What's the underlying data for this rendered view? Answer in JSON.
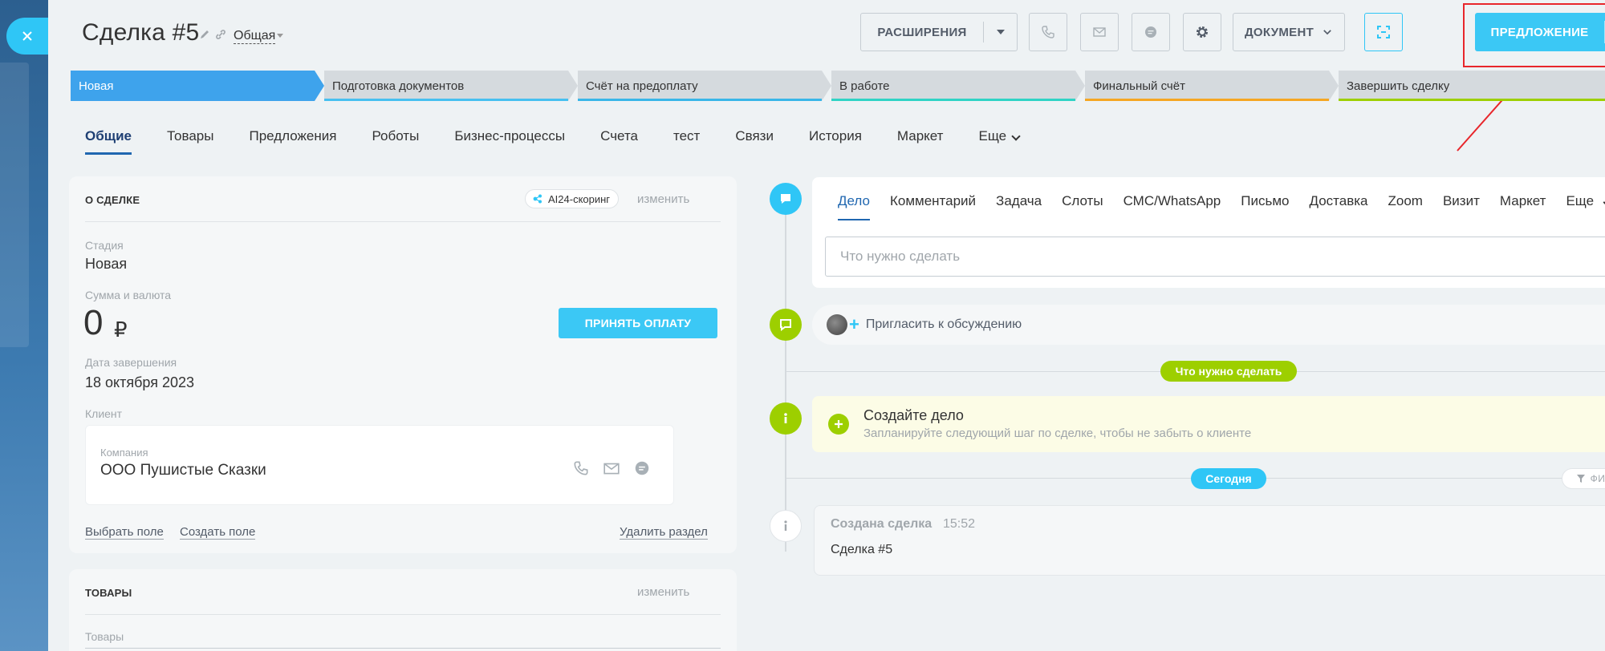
{
  "header": {
    "title": "Сделка #5",
    "category": "Общая",
    "buttons": {
      "extensions": "РАСШИРЕНИЯ",
      "document": "ДОКУМЕНТ",
      "offer": "ПРЕДЛОЖЕНИЕ"
    }
  },
  "stages": [
    {
      "label": "Новая",
      "active": true,
      "color": "#3ea3ec"
    },
    {
      "label": "Подготовка документов",
      "color": "#47c0f0"
    },
    {
      "label": "Счёт на предоплату",
      "color": "#39b6e8"
    },
    {
      "label": "В работе",
      "color": "#2fd3c5"
    },
    {
      "label": "Финальный счёт",
      "color": "#f5a623"
    },
    {
      "label": "Завершить сделку",
      "color": "#9dcf00"
    }
  ],
  "tabs": [
    "Общие",
    "Товары",
    "Предложения",
    "Роботы",
    "Бизнес-процессы",
    "Счета",
    "тест",
    "Связи",
    "История",
    "Маркет",
    "Еще"
  ],
  "about": {
    "title": "О СДЕЛКЕ",
    "ai_chip": "AI24-скоринг",
    "edit": "изменить",
    "stage_label": "Стадия",
    "stage_value": "Новая",
    "sum_label": "Сумма и валюта",
    "sum_value": "0",
    "currency": "₽",
    "pay_button": "ПРИНЯТЬ ОПЛАТУ",
    "date_label": "Дата завершения",
    "date_value": "18 октября 2023",
    "client_label": "Клиент",
    "company_label": "Компания",
    "company_value": "ООО Пушистые Сказки",
    "select_field": "Выбрать поле",
    "create_field": "Создать поле",
    "delete_section": "Удалить раздел"
  },
  "products": {
    "title": "ТОВАРЫ",
    "edit": "изменить",
    "field_label": "Товары"
  },
  "activity": {
    "tabs": [
      "Дело",
      "Комментарий",
      "Задача",
      "Слоты",
      "СМС/WhatsApp",
      "Письмо",
      "Доставка",
      "Zoom",
      "Визит",
      "Маркет",
      "Еще"
    ],
    "input_placeholder": "Что нужно сделать",
    "invite": "Пригласить к обсуждению",
    "todo_pill": "Что нужно сделать",
    "todo_title": "Создайте дело",
    "todo_subtitle": "Запланируйте следующий шаг по сделке, чтобы не забыть о клиенте",
    "today_pill": "Сегодня",
    "filter": "ФИЛЬТР",
    "history_title": "Создана сделка",
    "history_time": "15:52",
    "history_text": "Сделка #5"
  },
  "colors": {
    "accent": "#3bc8f5",
    "green": "#9dcf00",
    "highlight": "#e8262b"
  }
}
